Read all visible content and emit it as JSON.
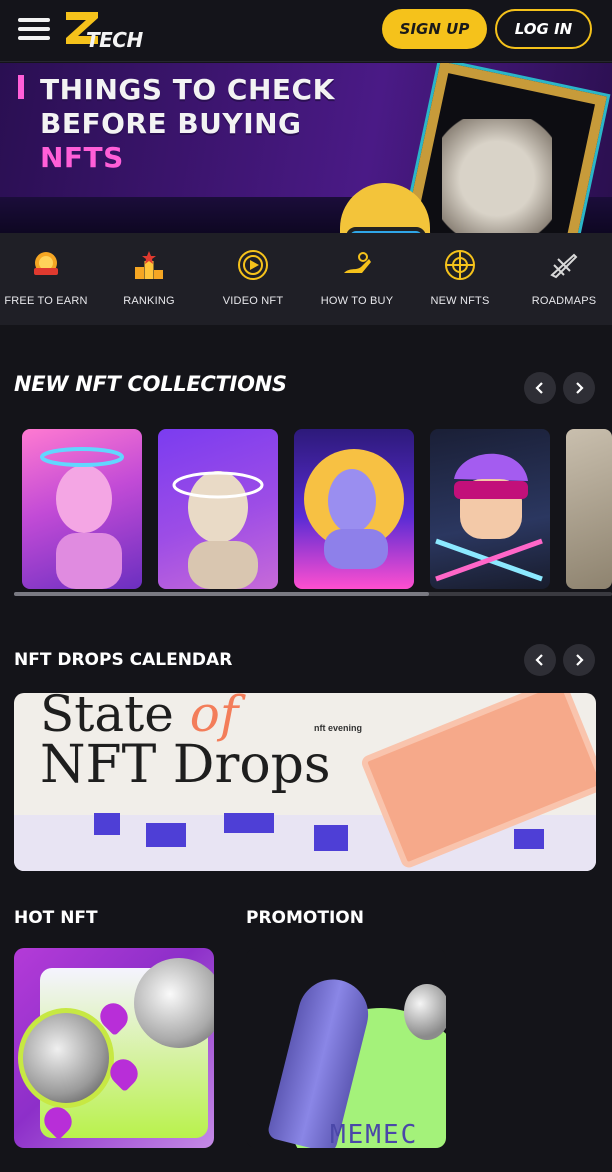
{
  "header": {
    "logo_text": "TECH",
    "signup_label": "SIGN UP",
    "login_label": "LOG IN"
  },
  "hero": {
    "line1": "THINGS TO CHECK",
    "line2": "BEFORE BUYING",
    "line3": "NFTS"
  },
  "categories": [
    {
      "label": "FREE TO EARN",
      "icon": "cash-back-coin-icon"
    },
    {
      "label": "RANKING",
      "icon": "podium-icon"
    },
    {
      "label": "VIDEO NFT",
      "icon": "play-circle-icon"
    },
    {
      "label": "HOW TO BUY",
      "icon": "hand-coin-icon"
    },
    {
      "label": "NEW NFTS",
      "icon": "ball-icon"
    },
    {
      "label": "ROADMAPS",
      "icon": "airplane-icon"
    }
  ],
  "collections": {
    "title": "NEW NFT COLLECTIONS"
  },
  "drops": {
    "title": "NFT DROPS CALENDAR",
    "banner_line1": "State",
    "banner_of": "of",
    "banner_line2": "NFT Drops",
    "banner_badge": "nft evening"
  },
  "hot": {
    "title": "HOT NFT"
  },
  "promotion": {
    "title": "PROMOTION",
    "tile_text": "MEMEC"
  },
  "colors": {
    "accent": "#f5c21b",
    "background": "#141419",
    "category_bar": "#1f1f26",
    "hero_pink": "#ff5fd8"
  }
}
